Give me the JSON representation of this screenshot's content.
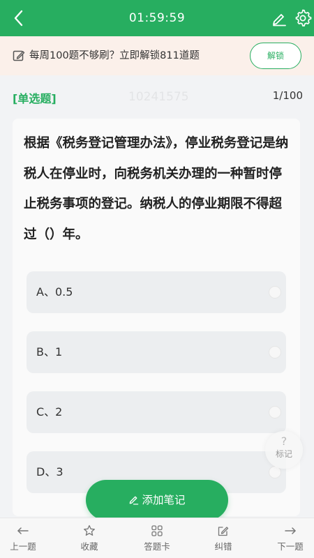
{
  "header": {
    "timer": "01:59:59"
  },
  "promo": {
    "text": "每周100题不够刷？立即解锁811道题",
    "unlock_label": "解锁"
  },
  "question": {
    "type_label": "[单选题]",
    "id": "10241575",
    "progress": "1/100",
    "stem": "根据《税务登记管理办法》，停业税务登记是纳税人在停业时，向税务机关办理的一种暂时停止税务事项的登记。纳税人的停业期限不得超过（）年。",
    "options": [
      {
        "label": "A、0.5"
      },
      {
        "label": "B、1"
      },
      {
        "label": "C、2"
      },
      {
        "label": "D、3"
      }
    ]
  },
  "mark": {
    "symbol": "?",
    "label": "标记"
  },
  "add_note": {
    "label": "添加笔记"
  },
  "bottom_nav": {
    "prev": "上一题",
    "favorite": "收藏",
    "answer_card": "答题卡",
    "report_error": "纠错",
    "next": "下一题"
  },
  "colors": {
    "primary": "#27ae60",
    "promo_bg": "#fbf0ea",
    "page_bg": "#f2f3f5",
    "option_bg": "#eceef0"
  }
}
